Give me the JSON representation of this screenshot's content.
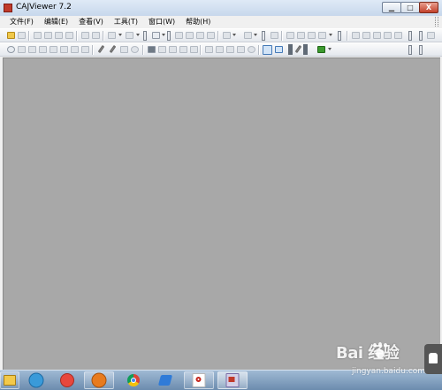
{
  "window": {
    "title": "CAJViewer 7.2",
    "controls": {
      "minimize": "▁",
      "maximize": "□",
      "close": "X"
    }
  },
  "menu": {
    "items": [
      "文件(F)",
      "编辑(E)",
      "查看(V)",
      "工具(T)",
      "窗口(W)",
      "帮助(H)"
    ]
  },
  "toolbars": {
    "row1_icons": [
      "open-folder-icon",
      "save-icon",
      "print-icon",
      "print-preview-icon",
      "copy-icon",
      "paste-icon",
      "find-icon",
      "undo-icon",
      "redo-icon",
      "text-select-icon",
      "page-icon",
      "two-page-icon",
      "continuous-icon",
      "rotate-icon",
      "fit-width-icon",
      "fit-page-icon",
      "zoom-in-icon",
      "zoom-out-icon",
      "first-page-icon",
      "prev-page-icon",
      "next-page-icon",
      "last-page-icon"
    ],
    "row2_icons": [
      "hand-tool-icon",
      "select-icon",
      "text-tool-icon",
      "image-tool-icon",
      "snapshot-icon",
      "ocr-icon",
      "pen-icon",
      "highlighter-icon",
      "rectangle-icon",
      "ellipse-icon",
      "note-icon",
      "bookmark-icon",
      "stamp-icon",
      "link-icon",
      "strikethrough-icon",
      "underline-icon",
      "annotation-icon",
      "search-doc-icon",
      "navigate-icon",
      "go-icon"
    ]
  },
  "taskbar": {
    "buttons": [
      "explorer-icon",
      "qq-icon",
      "video-player-icon",
      "firefox-icon",
      "chrome-icon",
      "feishu-icon",
      "acrobat-icon",
      "cajviewer-icon"
    ]
  },
  "watermark": {
    "brand": "Bai  经验",
    "url": "jingyan.baidu.com"
  },
  "colors": {
    "document_background": "#a8a8a8",
    "title_bar": "#c7d8ec",
    "taskbar": "#7f9fc1"
  }
}
